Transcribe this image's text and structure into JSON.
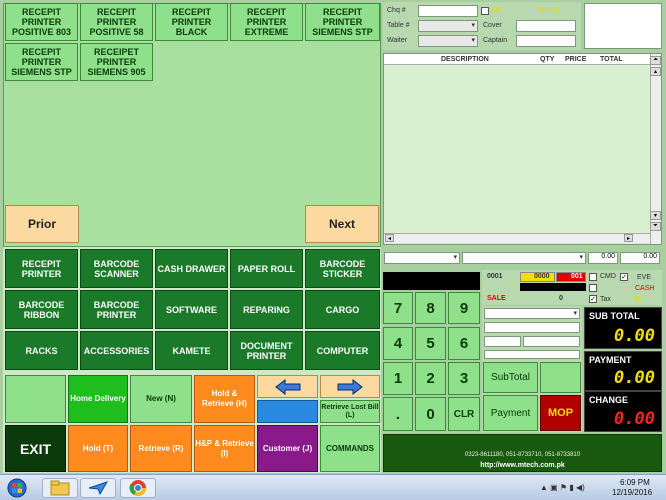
{
  "products": [
    {
      "label": "RECEPIT PRINTER POSITIVE 803"
    },
    {
      "label": "RECEPIT PRINTER POSITIVE 58"
    },
    {
      "label": "RECEPIT PRINTER BLACK"
    },
    {
      "label": "RECEPIT PRINTER EXTREME"
    },
    {
      "label": "RECEPIT PRINTER SIEMENS STP"
    },
    {
      "label": "RECEPIT PRINTER SIEMENS STP"
    },
    {
      "label": "RECEIPET PRINTER SIEMENS 905"
    }
  ],
  "nav": {
    "prior": "Prior",
    "next": "Next"
  },
  "categories": [
    {
      "label": "RECEPIT PRINTER"
    },
    {
      "label": "BARCODE SCANNER"
    },
    {
      "label": "CASH DRAWER"
    },
    {
      "label": "PAPER ROLL"
    },
    {
      "label": "BARCODE STICKER"
    },
    {
      "label": "BARCODE RIBBON"
    },
    {
      "label": "BARCODE PRINTER"
    },
    {
      "label": "SOFTWARE"
    },
    {
      "label": "REPARING"
    },
    {
      "label": "CARGO"
    },
    {
      "label": "RACKS"
    },
    {
      "label": "ACCESSORIES"
    },
    {
      "label": "KAMETE"
    },
    {
      "label": "DOCUMENT PRINTER"
    },
    {
      "label": "COMPUTER"
    }
  ],
  "actions": {
    "home_delivery": "Home Delivery",
    "new": "New (N)",
    "hold_retrieve": "Hold & Retrieve (H)",
    "retrieve_lost": "Retrieve Lost Bill (L)",
    "exit": "EXIT",
    "hold": "Hold (T)",
    "retrieve": "Retrieve (R)",
    "hp_retrieve": "H&P & Retrieve (I)",
    "customer": "Customer (J)",
    "commands": "COMMANDS"
  },
  "order_form": {
    "chq_label": "Chq #",
    "table_label": "Table #",
    "waiter_label": "Waiter",
    "mt_label": "MT",
    "order_no": "000047",
    "cover_label": "Cover",
    "captain_label": "Captain"
  },
  "grid": {
    "headers": [
      "DESCRIPTION",
      "QTY",
      "PRICE",
      "TOTAL"
    ]
  },
  "below_grid": {
    "val1": "0.00",
    "val2": "0.00"
  },
  "status": {
    "code1": "0001",
    "code2": "0000",
    "code3": "001",
    "sale_label": "SALE",
    "sale_value": "0",
    "cmd_label": "CMD",
    "tax_label": "Tax",
    "eve_label": "EVE",
    "cash_label": "CASH",
    "in_label": "IN"
  },
  "keypad": {
    "keys": [
      "7",
      "8",
      "9",
      "4",
      "5",
      "6",
      "1",
      "2",
      "3",
      ".",
      "0",
      "CLR"
    ],
    "subtotal_btn": "SubTotal",
    "payment_btn": "Payment",
    "mop_btn": "MOP"
  },
  "totals": {
    "sub_total_label": "SUB TOTAL",
    "sub_total_value": "0.00",
    "payment_label": "PAYMENT",
    "payment_value": "0.00",
    "change_label": "CHANGE",
    "change_value": "0.00"
  },
  "footer": {
    "phones": "0323-8611180, 051-8733710, 051-8733810",
    "website": "http://www.mtech.com.pk"
  },
  "taskbar": {
    "time": "6:09 PM",
    "date": "12/19/2016"
  },
  "colors": {
    "accent_green": "#1a7a2a",
    "change_red": "#ff2020",
    "lcd_yellow": "#f0e000"
  }
}
